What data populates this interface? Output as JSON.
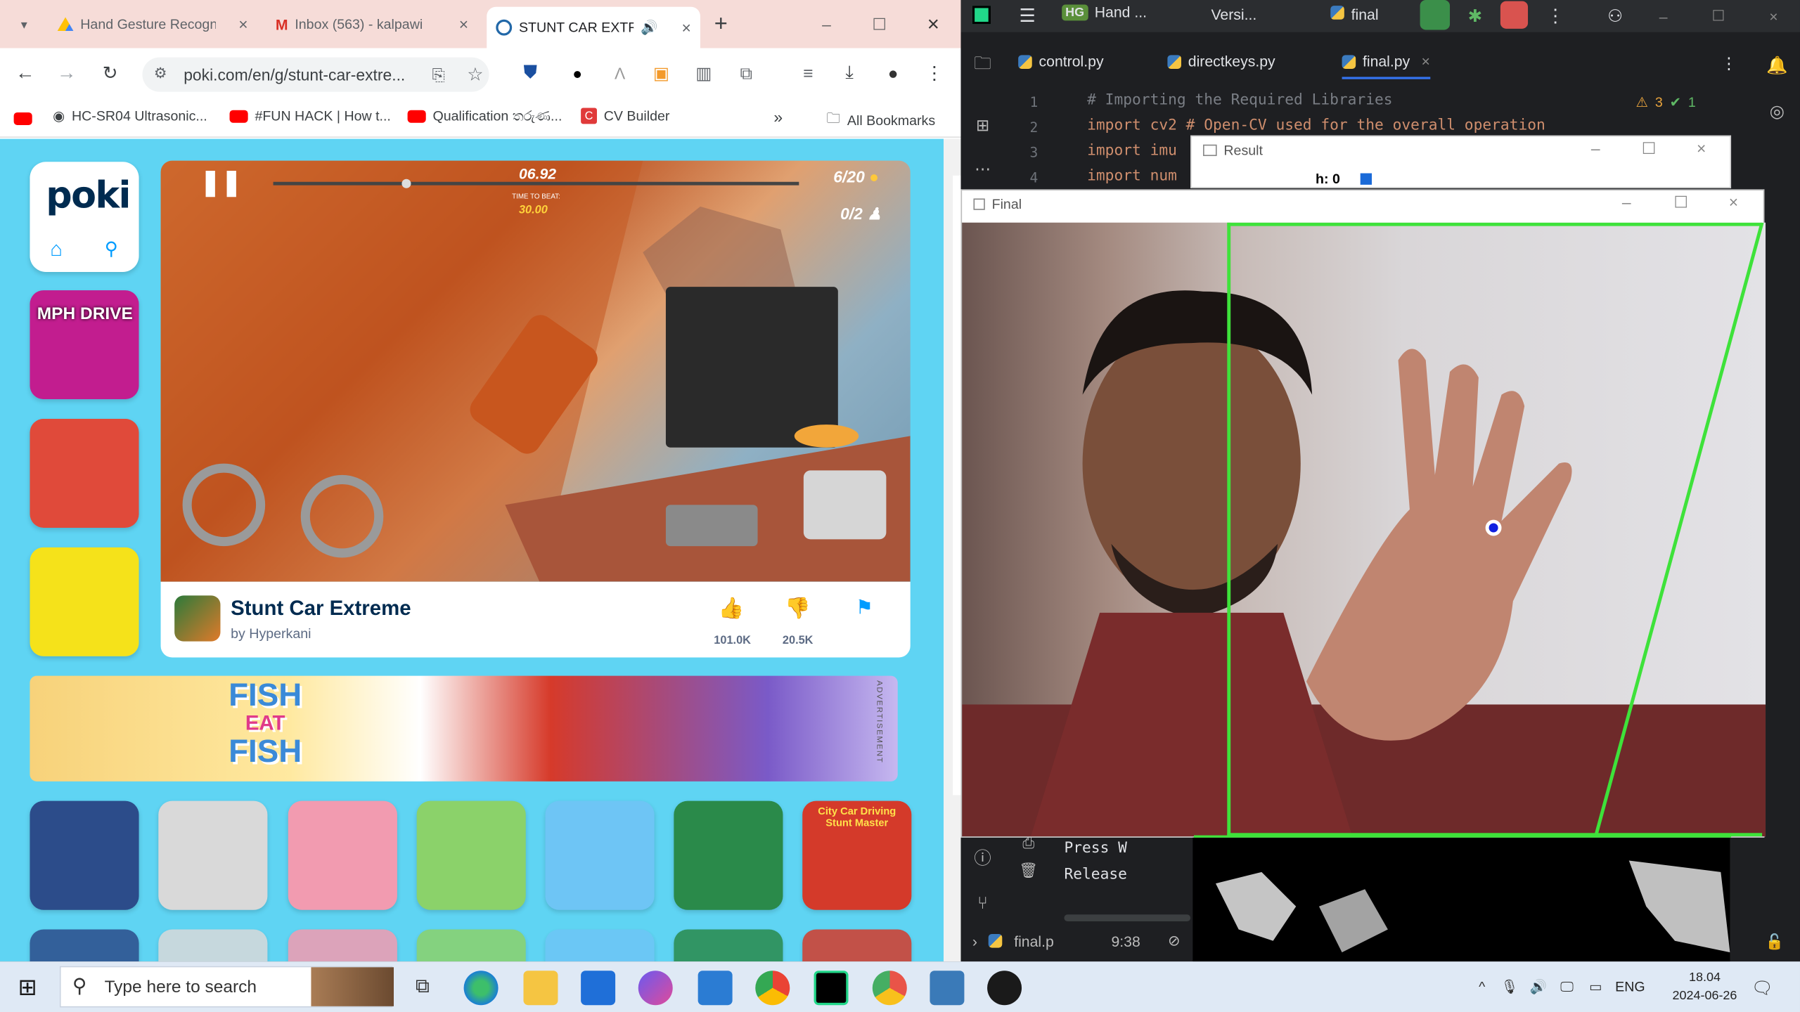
{
  "browser": {
    "tabs": [
      {
        "title": "Hand Gesture Recogn"
      },
      {
        "title": "Inbox (563) - kalpawi"
      },
      {
        "title": "STUNT CAR EXTR"
      }
    ],
    "url": "poki.com/en/g/stunt-car-extre...",
    "bookmarks": [
      "HC-SR04 Ultrasonic...",
      "#FUN HACK | How t...",
      "Qualification තරුණ...",
      "CV Builder"
    ],
    "all_bookmarks": "All Bookmarks",
    "more": "»"
  },
  "poki": {
    "logo_text": "poki",
    "game_hud": {
      "timer": "06.92",
      "time_to_beat_label": "TIME TO BEAT:",
      "time_to_beat": "30.00",
      "coins": "6/20",
      "stunts": "0/2"
    },
    "game": {
      "title": "Stunt Car Extreme",
      "developer": "by Hyperkani",
      "likes": "101.0K",
      "dislikes": "20.5K"
    },
    "ad": {
      "title_line1": "FISH",
      "title_line2": "EAT",
      "title_line3": "FISH",
      "tag": "ADVERTISEMENT"
    },
    "sidebar_tiles": [
      {
        "label": "MPH DRIVE",
        "color": "#c21d8f"
      },
      {
        "label": "",
        "color": "#e04a3a"
      },
      {
        "label": "",
        "color": "#f5e21a"
      }
    ],
    "grid_tiles": [
      {
        "label": "",
        "color": "#2c4c8a"
      },
      {
        "label": "",
        "color": "#d9d9d9"
      },
      {
        "label": "",
        "color": "#f29bb0"
      },
      {
        "label": "",
        "color": "#8bd26a"
      },
      {
        "label": "",
        "color": "#6ec5f5"
      },
      {
        "label": "",
        "color": "#2a8a4a"
      },
      {
        "label": "City Car Driving Stunt Master",
        "color": "#d43a2a"
      }
    ]
  },
  "ide": {
    "project": "Hand ...",
    "project_badge": "HG",
    "vcs": "Versi...",
    "run_config": "final",
    "tabs": [
      "control.py",
      "directkeys.py",
      "final.py"
    ],
    "code": [
      {
        "num": "1",
        "text": "# Importing the Required Libraries"
      },
      {
        "num": "2",
        "text": "import cv2  # Open-CV used for the overall operation"
      },
      {
        "num": "3",
        "text": "import imu"
      },
      {
        "num": "4",
        "text": "import num"
      }
    ],
    "inspections": {
      "warnings": "3",
      "ok": "1"
    },
    "console": [
      "Press W",
      "Release"
    ],
    "status_file": "final.p",
    "status_pos": "9:38"
  },
  "cv_windows": {
    "result_title": "Result",
    "result_text": "h: 0",
    "final_title": "Final"
  },
  "taskbar": {
    "search_placeholder": "Type here to search",
    "lang": "ENG",
    "time": "18.04",
    "date": "2024-06-26"
  },
  "colors": {
    "green_box": "#3ee23a",
    "tracker_dot": "#1020e0",
    "chrome_tab": "#f6dcd8",
    "poki_bg": "#5fd4f3"
  }
}
